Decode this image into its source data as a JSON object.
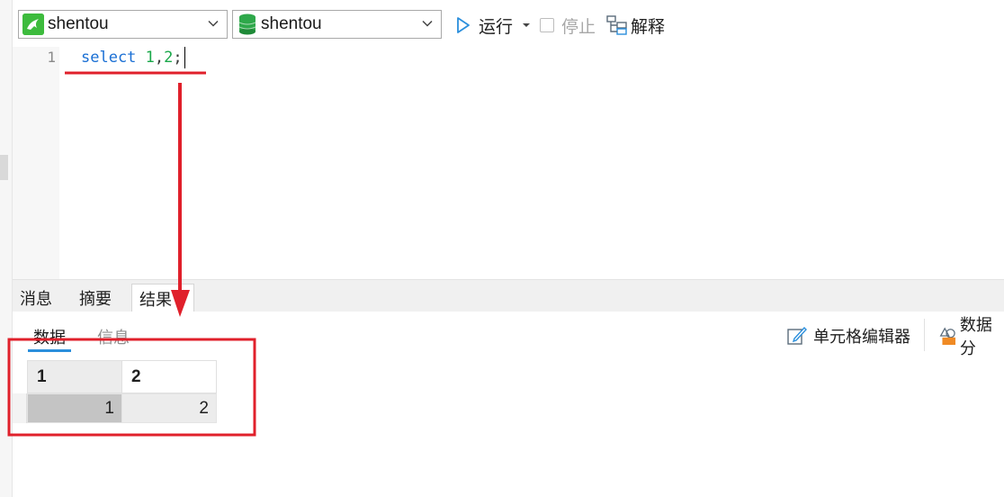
{
  "toolbar": {
    "connection_select": {
      "value": "shentou",
      "icon": "mysql-connection-icon"
    },
    "database_select": {
      "value": "shentou",
      "icon": "database-icon"
    },
    "run_label": "运行",
    "stop_label": "停止",
    "explain_label": "解释"
  },
  "editor": {
    "line_number": "1",
    "code_tokens": {
      "keyword": "select",
      "num1": "1",
      "comma": ",",
      "num2": "2",
      "semicolon": ";"
    }
  },
  "tabs": [
    {
      "label": "消息"
    },
    {
      "label": "摘要"
    },
    {
      "label": "结果"
    }
  ],
  "result": {
    "subtabs": [
      {
        "label": "数据"
      },
      {
        "label": "信息"
      }
    ],
    "cell_editor_label": "单元格编辑器",
    "data_tool_label": "数据分",
    "columns": [
      "1",
      "2"
    ],
    "rows": [
      [
        "1",
        "2"
      ]
    ]
  },
  "colors": {
    "accent": "#2b8fdc",
    "annotation": "#e0202b",
    "keyword": "#1a6fd4",
    "number": "#1aa84a"
  }
}
